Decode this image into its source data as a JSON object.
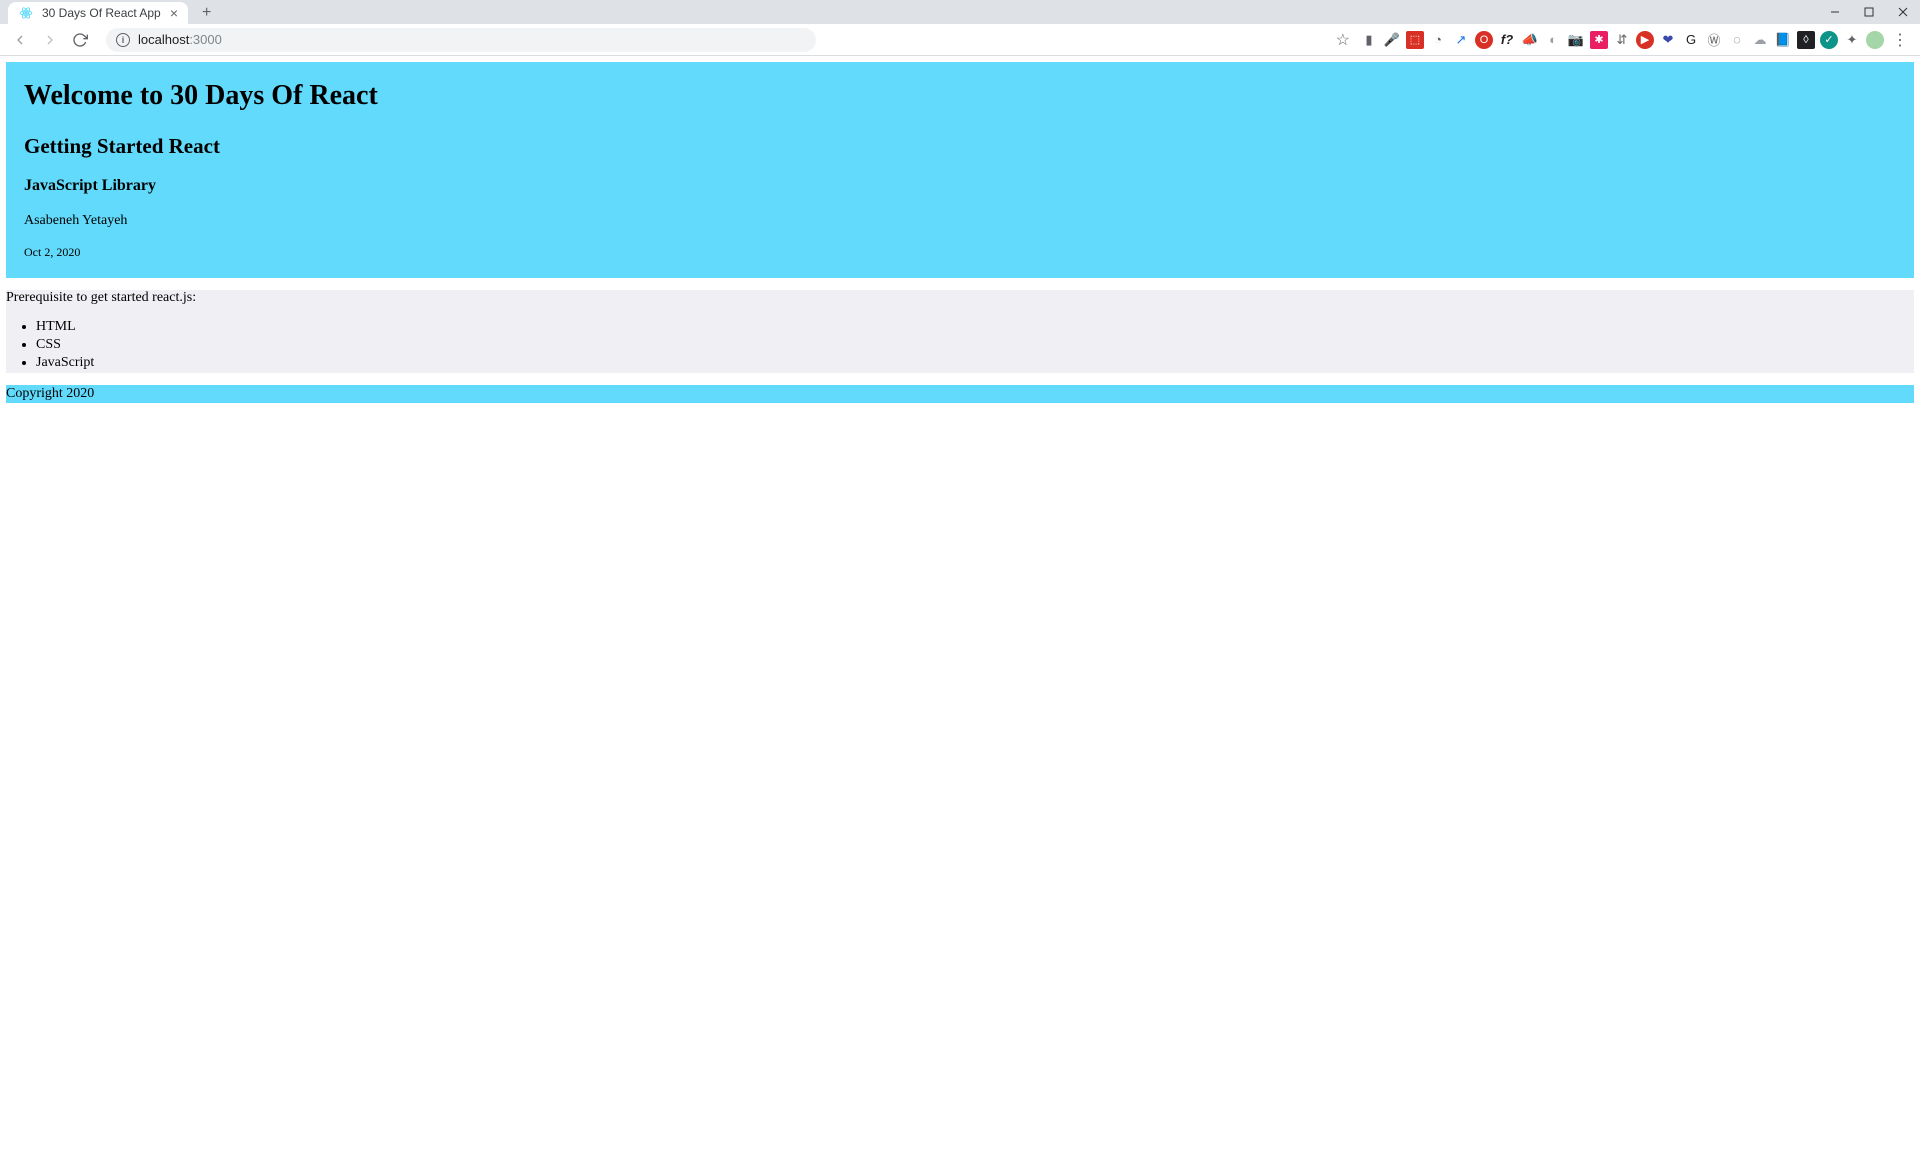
{
  "browser": {
    "tab_title": "30 Days Of React App",
    "url_host": "localhost",
    "url_port": ":3000"
  },
  "header": {
    "title": "Welcome to 30 Days Of React",
    "subtitle": "Getting Started React",
    "library": "JavaScript Library",
    "author": "Asabeneh Yetayeh",
    "date": "Oct 2, 2020"
  },
  "main": {
    "prereq_label": "Prerequisite to get started react.js:",
    "prereqs": [
      "HTML",
      "CSS",
      "JavaScript"
    ]
  },
  "footer": {
    "copyright": "Copyright 2020"
  }
}
